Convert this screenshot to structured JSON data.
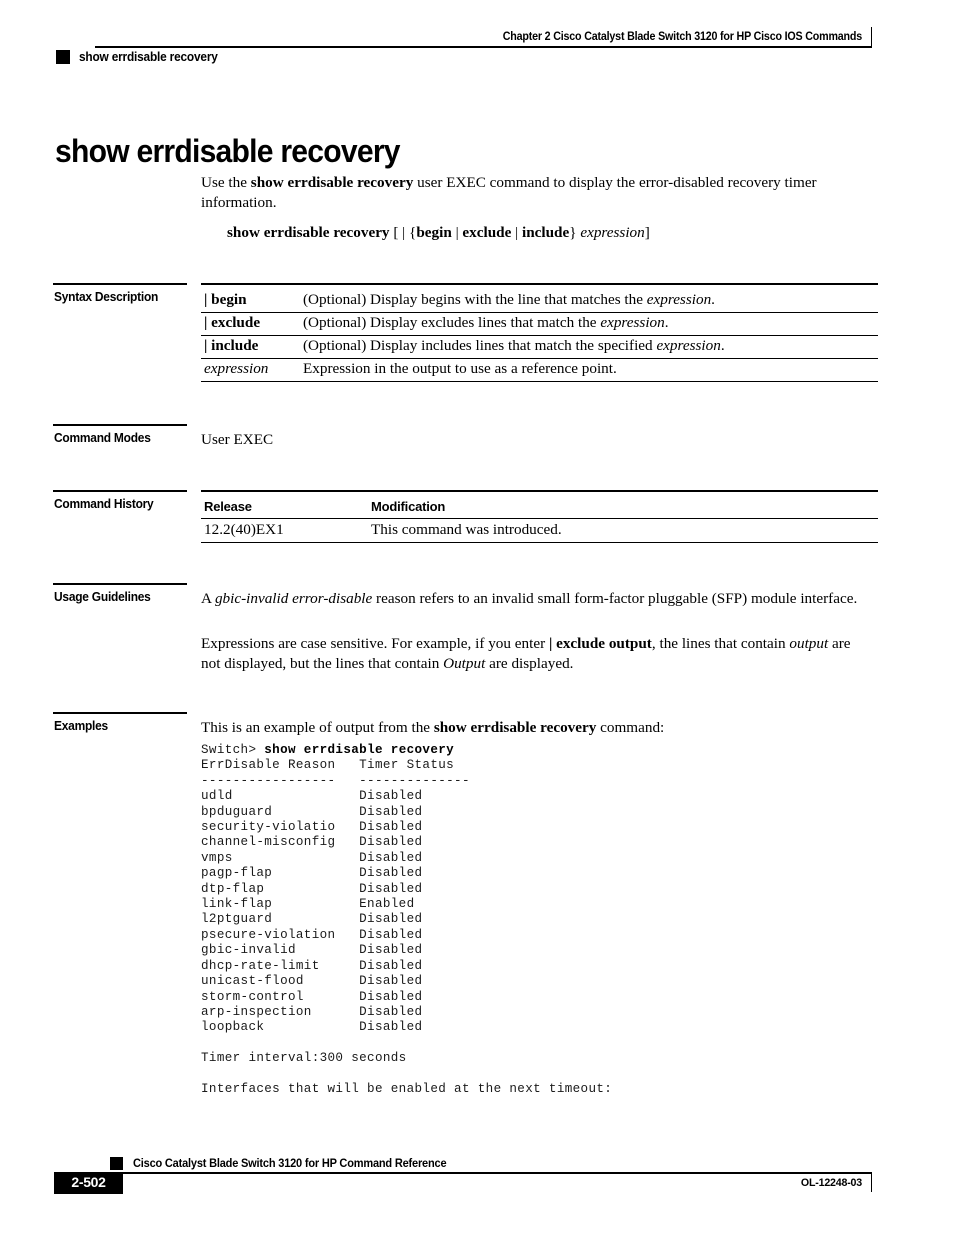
{
  "header": {
    "chapter": "Chapter  2 Cisco Catalyst Blade Switch 3120 for HP Cisco IOS Commands",
    "command_name": "show errdisable recovery"
  },
  "title": "show errdisable recovery",
  "intro": {
    "lead": "Use the ",
    "command_bold": "show errdisable recovery",
    "rest": " user EXEC command to display the error-disabled recovery timer information."
  },
  "syntax": {
    "command": "show errdisable recovery",
    "bracket_open": " [ | {",
    "begin": "begin",
    "sep1": " | ",
    "exclude": "exclude",
    "sep2": " | ",
    "include": "include",
    "brace_close": "} ",
    "expression": "expression",
    "bracket_close": "]"
  },
  "sections": {
    "syntax_description": "Syntax Description",
    "command_modes": "Command Modes",
    "command_history": "Command History",
    "usage_guidelines": "Usage Guidelines",
    "examples": "Examples"
  },
  "syntax_table": {
    "rows": [
      {
        "term_pipe": "| ",
        "term": "begin",
        "term_italic": false,
        "desc_pre": "(Optional) Display begins with the line that matches the ",
        "desc_italic": "expression",
        "desc_post": "."
      },
      {
        "term_pipe": "| ",
        "term": "exclude",
        "term_italic": false,
        "desc_pre": "(Optional) Display excludes lines that match the ",
        "desc_italic": "expression",
        "desc_post": "."
      },
      {
        "term_pipe": "| ",
        "term": "include",
        "term_italic": false,
        "desc_pre": "(Optional) Display includes lines that match the specified ",
        "desc_italic": "expression",
        "desc_post": "."
      },
      {
        "term_pipe": "",
        "term": "expression",
        "term_italic": true,
        "desc_pre": "Expression in the output to use as a reference point.",
        "desc_italic": "",
        "desc_post": ""
      }
    ]
  },
  "command_modes": {
    "value": "User EXEC"
  },
  "command_history": {
    "col_release": "Release",
    "col_modification": "Modification",
    "rows": [
      {
        "release": "12.2(40)EX1",
        "modification": "This command was introduced."
      }
    ]
  },
  "usage_guidelines": {
    "p1_pre": "A ",
    "p1_italic": "gbic-invalid error-disable",
    "p1_post": " reason refers to an invalid small form-factor pluggable (SFP) module interface.",
    "p2_pre": "Expressions are case sensitive. For example, if you enter ",
    "p2_bold": "| exclude output",
    "p2_mid": ", the lines that contain ",
    "p2_italic1": "output",
    "p2_mid2": " are not displayed, but the lines that contain ",
    "p2_italic2": "Output",
    "p2_post": " are displayed."
  },
  "examples": {
    "lead_pre": "This is an example of output from the ",
    "lead_bold": "show errdisable recovery",
    "lead_post": " command:",
    "prompt": "Switch> ",
    "typed_command": "show errdisable recovery",
    "output_lines": [
      "ErrDisable Reason   Timer Status",
      "-----------------   --------------",
      "udld                Disabled",
      "bpduguard           Disabled",
      "security-violatio   Disabled",
      "channel-misconfig   Disabled",
      "vmps                Disabled",
      "pagp-flap           Disabled",
      "dtp-flap            Disabled",
      "link-flap           Enabled",
      "l2ptguard           Disabled",
      "psecure-violation   Disabled",
      "gbic-invalid        Disabled",
      "dhcp-rate-limit     Disabled",
      "unicast-flood       Disabled",
      "storm-control       Disabled",
      "arp-inspection      Disabled",
      "loopback            Disabled",
      "",
      "Timer interval:300 seconds",
      "",
      "Interfaces that will be enabled at the next timeout:"
    ]
  },
  "footer": {
    "book_title": "Cisco Catalyst Blade Switch 3120 for HP Command Reference",
    "page_number": "2-502",
    "doc_id": "OL-12248-03"
  }
}
